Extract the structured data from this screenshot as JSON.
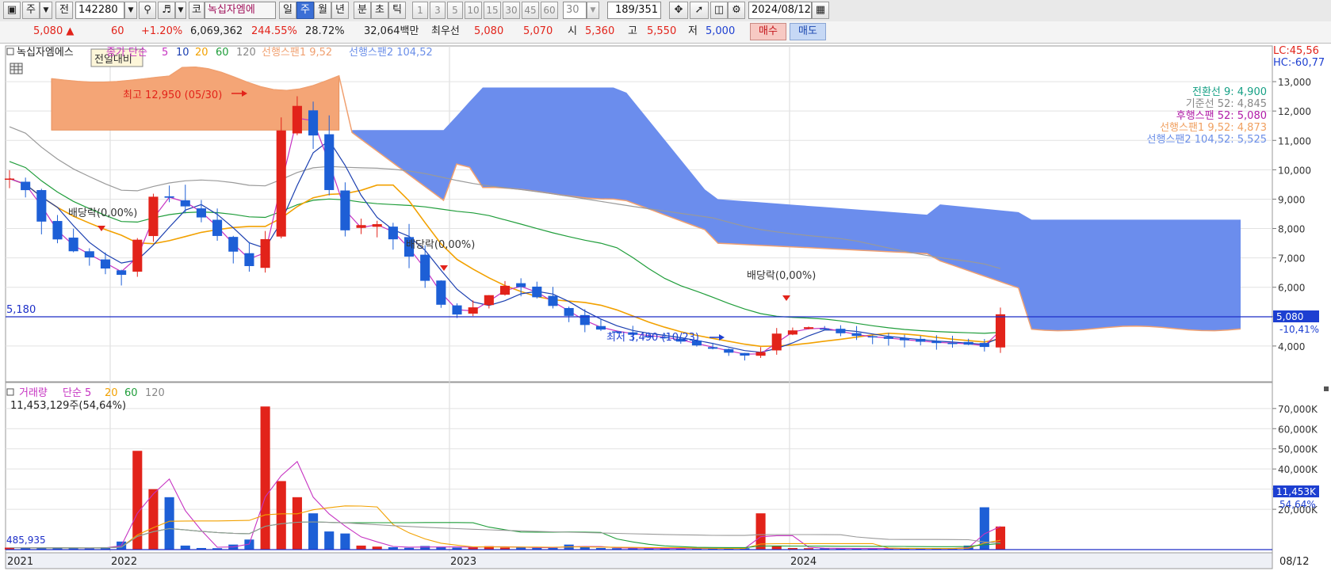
{
  "toolbar": {
    "market_mode": "주",
    "prev_label": "전",
    "code": "142280",
    "market_tag": "코",
    "stock_name": "녹십자엠에",
    "periods": [
      "일",
      "주",
      "월",
      "년",
      "분",
      "초",
      "틱"
    ],
    "selected_period": "주",
    "intervals": [
      "1",
      "3",
      "5",
      "10",
      "15",
      "30",
      "45",
      "60"
    ],
    "interval_value": "30",
    "page_counter": "189/351",
    "date": "2024/08/12"
  },
  "quote": {
    "price": "5,080 ▲",
    "change": "60",
    "change_pct": "+1.20%",
    "volume": "6,069,362",
    "volume_ratio": "244.55%",
    "turnover": "28.72%",
    "amount": "32,064백만",
    "best_ask_label": "최우선",
    "best_ask": "5,080",
    "best_bid": "5,070",
    "open_label": "시",
    "open": "5,360",
    "high_label": "고",
    "high": "5,550",
    "low_label": "저",
    "low": "5,000",
    "buy_label": "매수",
    "sell_label": "매도"
  },
  "price_panel": {
    "stock_label": "녹십자엠에스",
    "tooltip": "전일대비",
    "legend": {
      "ma_prefix": "종가 단순",
      "ma5": "5",
      "ma10": "10",
      "ma20": "20",
      "ma60": "60",
      "ma120": "120",
      "span1": "선행스팬1 9,52",
      "span2": "선행스팬2 104,52"
    },
    "lc": "LC:45,56",
    "hc": "HC:-60,77",
    "ichimoku": [
      {
        "label": "전환선 9: 4,900",
        "color": "#16a085"
      },
      {
        "label": "기준선 52: 4,845",
        "color": "#888888"
      },
      {
        "label": "후행스팬 52: 5,080",
        "color": "#b01aa6"
      },
      {
        "label": "선행스팬1 9,52: 4,873",
        "color": "#f0a060"
      },
      {
        "label": "선행스팬2 104,52: 5,525",
        "color": "#6a8ee8"
      }
    ],
    "annotations": {
      "high": "최고 12,950 (05/30)",
      "low": "최저 3,490 (10/23)",
      "div1": "배당락(0,00%)",
      "div2": "배당락(0,00%)",
      "div3": "배당락(0,00%)"
    },
    "hline_label": "5,180",
    "current_price": "5,080",
    "current_pct": "-10,41%",
    "axis": [
      "13,000",
      "12,000",
      "11,000",
      "10,000",
      "9,000",
      "8,000",
      "7,000",
      "6,000",
      "5,000",
      "4,000"
    ]
  },
  "volume_panel": {
    "legend_title": "거래량",
    "legend_ma": "단순 5",
    "legend_20": "20",
    "legend_60": "60",
    "legend_120": "120",
    "current_text": "11,453,129주(54,64%)",
    "base_label": "485,935",
    "axis": [
      "70,000K",
      "60,000K",
      "50,000K",
      "40,000K",
      "30,000K",
      "20,000K"
    ],
    "current_vol": "11,453K",
    "current_pct": "54,64%"
  },
  "x_axis": {
    "labels": [
      "2021",
      "2022",
      "2023",
      "2024"
    ],
    "end_label": "08/12"
  },
  "colors": {
    "up": "#e2231a",
    "down": "#1d5fd6",
    "cloud_up": "#f4a576",
    "cloud_down": "#6b8ded"
  },
  "chart_data": {
    "type": "candlestick",
    "title": "",
    "interval": "weekly",
    "x": [
      "2021",
      "2022",
      "2023",
      "2024",
      "08/12"
    ],
    "ylim": [
      3000,
      14000
    ],
    "price_high": 12950,
    "price_high_date": "05/30",
    "price_low": 3490,
    "price_low_date": "10/23",
    "last_close": 5080,
    "reference_line": 5180,
    "series": [
      {
        "name": "종가",
        "values": [
          9700,
          9300,
          8200,
          7600,
          7200,
          7000,
          6600,
          6400,
          7800,
          9300,
          9000,
          8700,
          8300,
          7600,
          7100,
          6600,
          8000,
          12600,
          12000,
          10800,
          8600,
          7600,
          8400,
          8000,
          7400,
          6800,
          5800,
          5100,
          5050,
          5550,
          5900,
          6200,
          5800,
          5500,
          5200,
          4800,
          4600,
          4500,
          4400,
          4350,
          4300,
          4200,
          4050,
          3950,
          3800,
          3700,
          3600,
          4400,
          4500,
          4650,
          4600,
          4450,
          4350,
          4300,
          4250,
          4200,
          4150,
          4100,
          4100,
          4050,
          3950,
          5080
        ]
      },
      {
        "name": "거래량",
        "values": [
          1000,
          900,
          850,
          800,
          700,
          700,
          1200,
          4000,
          49000,
          30000,
          26000,
          2000,
          800,
          700,
          2500,
          5000,
          71000,
          34000,
          26000,
          18000,
          9000,
          8000,
          2000,
          1500,
          1200,
          900,
          1800,
          1200,
          1000,
          1500,
          1700,
          1000,
          1100,
          900,
          900,
          2500,
          1200,
          800,
          700,
          700,
          600,
          600,
          700,
          600,
          500,
          500,
          700,
          18000,
          2000,
          800,
          700,
          600,
          600,
          600,
          500,
          500,
          600,
          500,
          500,
          500,
          2000,
          21000,
          11453
        ]
      }
    ]
  }
}
